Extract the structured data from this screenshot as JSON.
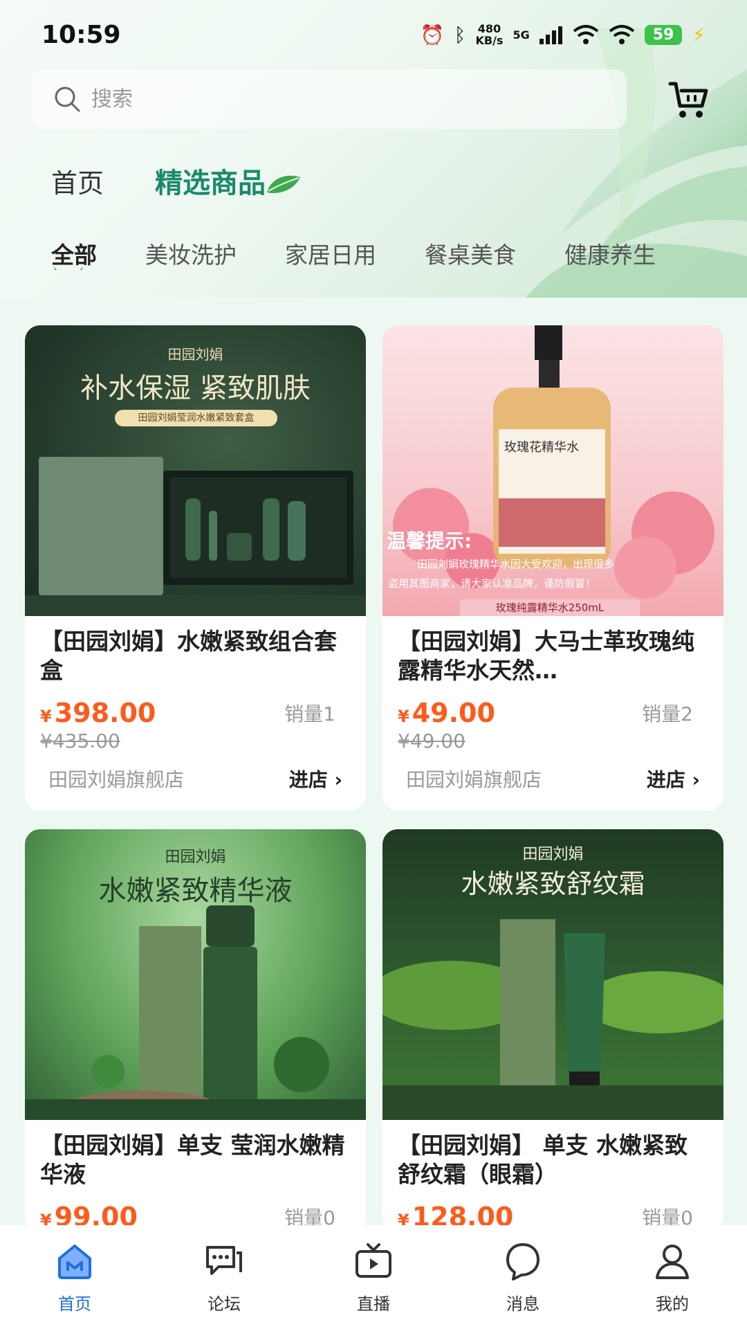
{
  "status_bar": {
    "time": "10:59",
    "speed_value": "480",
    "speed_unit": "KB/s",
    "network": "5G",
    "battery": "59",
    "icons": [
      "alarm-icon",
      "bluetooth-icon",
      "signal-icon",
      "wifi-icon",
      "wifi-icon",
      "battery-icon",
      "charging-icon"
    ]
  },
  "search": {
    "placeholder": "搜索",
    "icon": "search-icon"
  },
  "header": {
    "cart_icon": "cart-icon"
  },
  "top_tabs": {
    "home": "首页",
    "featured": "精选商品"
  },
  "category_tabs": [
    "全部",
    "美妆洗护",
    "家居日用",
    "餐桌美食",
    "健康养生"
  ],
  "products": [
    {
      "title": "【田园刘娟】水嫩紧致组合套盒",
      "price_symbol": "¥",
      "price": "398.00",
      "original_price": "¥435.00",
      "sales": "销量1",
      "shop": "田园刘娟旗舰店",
      "enter": "进店",
      "image": {
        "brand": "田园刘娟",
        "headline": "补水保湿 紧致肌肤",
        "tag": "田园刘娟莹润水嫩紧致套盒"
      }
    },
    {
      "title": "【田园刘娟】大马士革玫瑰纯露精华水天然…",
      "price_symbol": "¥",
      "price": "49.00",
      "original_price": "¥49.00",
      "sales": "销量2",
      "shop": "田园刘娟旗舰店",
      "enter": "进店",
      "image": {
        "bottle_label": "玫瑰花精华水",
        "notice_title": "温馨提示:",
        "notice_line1": "田园刘娟玫瑰精华水因大受欢迎，出现很多",
        "notice_line2": "盗用其图商家，请大家认准品牌，谨防假冒！",
        "tag": "玫瑰纯露精华水250mL"
      }
    },
    {
      "title": "【田园刘娟】单支 莹润水嫩精华液",
      "price_symbol": "¥",
      "price": "99.00",
      "sales": "销量0",
      "image": {
        "brand": "田园刘娟",
        "headline": "水嫩紧致精华液"
      }
    },
    {
      "title": "【田园刘娟】 单支 水嫩紧致舒纹霜（眼霜）",
      "price_symbol": "¥",
      "price": "128.00",
      "sales": "销量0",
      "image": {
        "brand": "田园刘娟",
        "headline": "水嫩紧致舒纹霜"
      }
    }
  ],
  "bottom_nav": [
    {
      "label": "首页",
      "icon": "home-icon",
      "active": true
    },
    {
      "label": "论坛",
      "icon": "forum-icon"
    },
    {
      "label": "直播",
      "icon": "live-icon"
    },
    {
      "label": "消息",
      "icon": "message-icon"
    },
    {
      "label": "我的",
      "icon": "profile-icon"
    }
  ],
  "colors": {
    "accent": "#1a8a6a",
    "price": "#ff5a1a",
    "nav_active": "#1d6fe0",
    "background": "#eef8f3"
  }
}
